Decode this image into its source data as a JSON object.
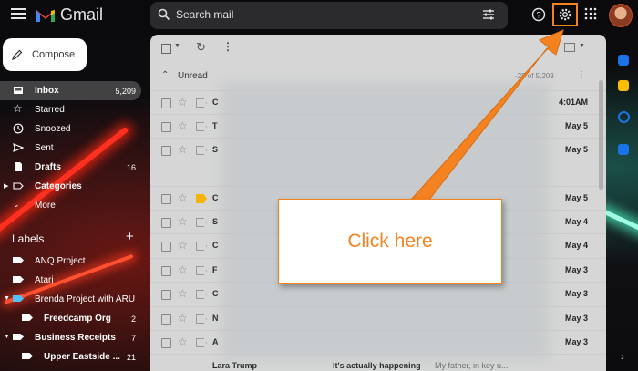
{
  "header": {
    "app_name": "Gmail",
    "search_placeholder": "Search mail"
  },
  "sidebar": {
    "compose_label": "Compose",
    "items": [
      {
        "label": "Inbox",
        "count": "5,209"
      },
      {
        "label": "Starred",
        "count": ""
      },
      {
        "label": "Snoozed",
        "count": ""
      },
      {
        "label": "Sent",
        "count": ""
      },
      {
        "label": "Drafts",
        "count": "16"
      },
      {
        "label": "Categories",
        "count": ""
      },
      {
        "label": "More",
        "count": ""
      }
    ],
    "labels_title": "Labels",
    "labels": [
      {
        "label": "ANQ Project",
        "count": ""
      },
      {
        "label": "Atari",
        "count": ""
      },
      {
        "label": "Brenda Project with ARU",
        "count": ""
      },
      {
        "label": "Freedcamp Org",
        "count": "2"
      },
      {
        "label": "Business Receipts",
        "count": "7"
      },
      {
        "label": "Upper Eastside ...",
        "count": "21"
      }
    ]
  },
  "main": {
    "section_label": "Unread",
    "pagination": "-25 of 5,209",
    "rows": [
      {
        "date": "4:01AM",
        "sender": "C"
      },
      {
        "date": "May 5",
        "sender": "T"
      },
      {
        "date": "May 5",
        "sender": "S"
      },
      {
        "date": "May 5",
        "sender": "C"
      },
      {
        "date": "May 4",
        "sender": "S"
      },
      {
        "date": "May 4",
        "sender": "C"
      },
      {
        "date": "May 3",
        "sender": "F"
      },
      {
        "date": "May 3",
        "sender": "C"
      },
      {
        "date": "May 3",
        "sender": "N"
      },
      {
        "date": "May 3",
        "sender": "A"
      }
    ],
    "last_row": {
      "sender": "Lara Trump",
      "subject": "It's actually happening",
      "snippet": "My father, in key u..."
    }
  },
  "callout": {
    "text": "Click here",
    "color": "#f58220"
  }
}
